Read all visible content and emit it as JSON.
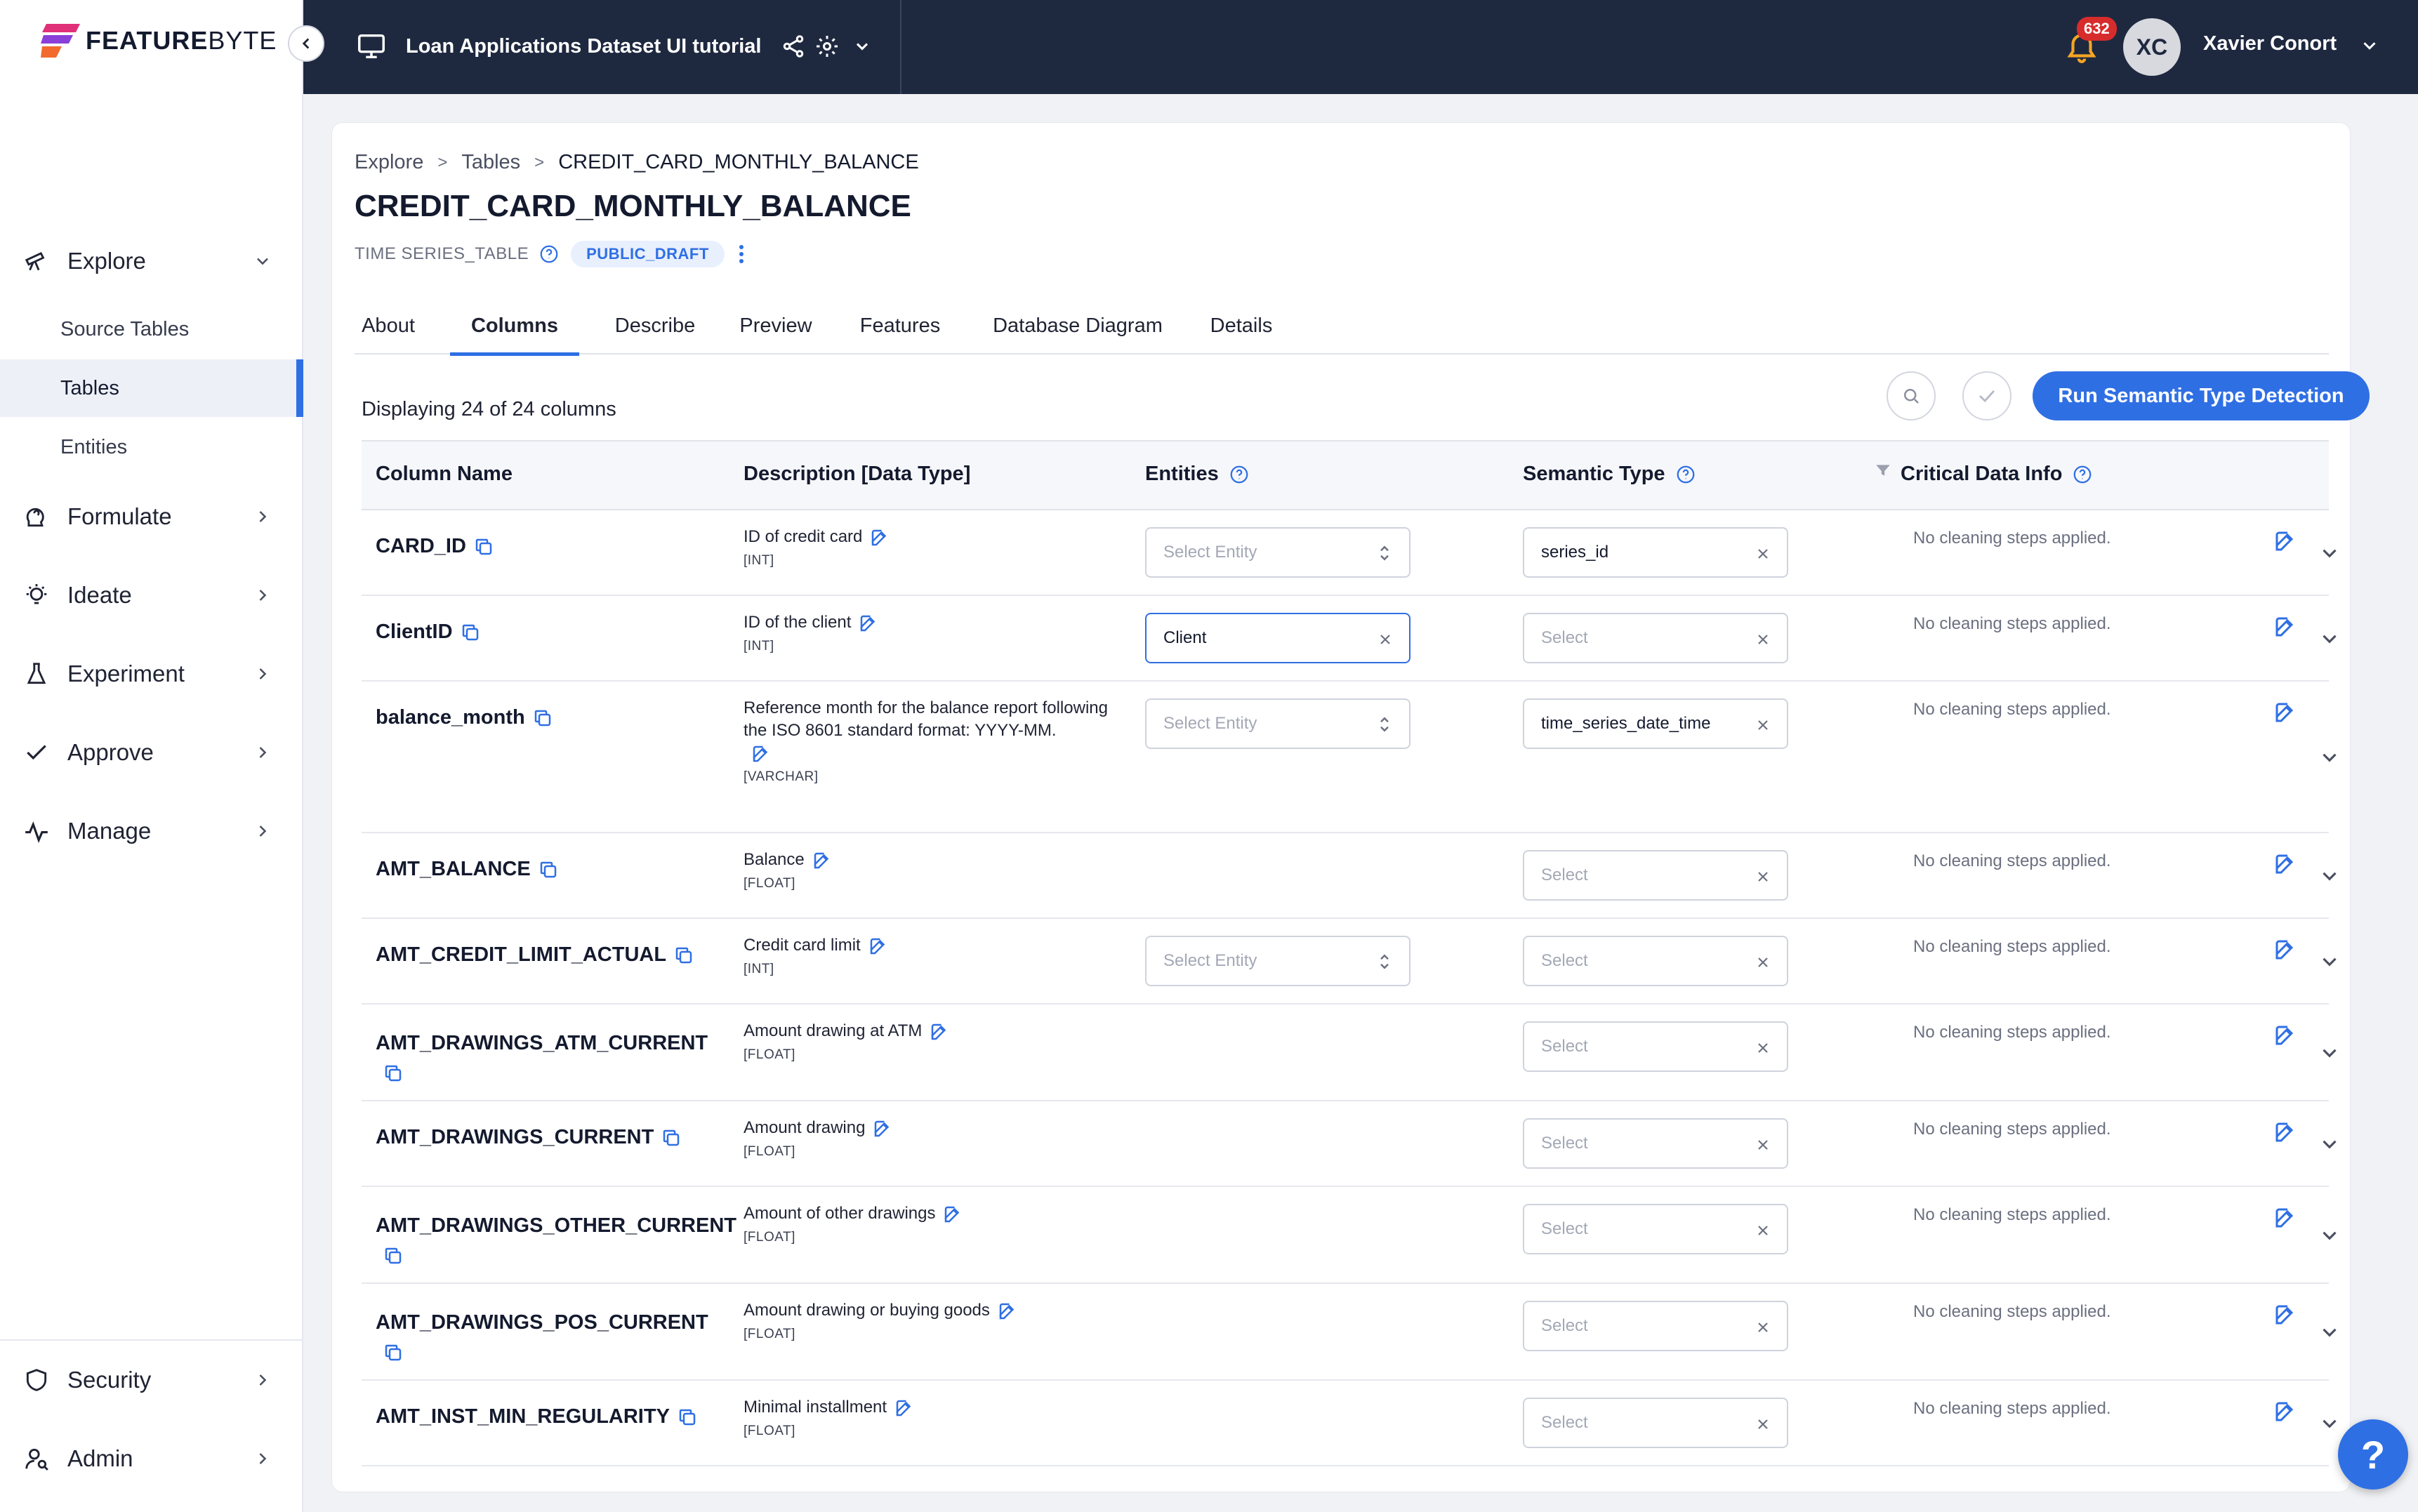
{
  "app": {
    "logo_text_bold": "FEATURE",
    "logo_text_light": "BYTE",
    "project_name": "Loan Applications Dataset UI tutorial",
    "notifications_count": "632",
    "user_initials": "XC",
    "user_name": "Xavier Conort",
    "accent_color": "#2f6fe4",
    "topbar_color": "#1e2940"
  },
  "sidebar": {
    "explore": "Explore",
    "sub": [
      "Source Tables",
      "Tables",
      "Entities"
    ],
    "items": [
      "Formulate",
      "Ideate",
      "Experiment",
      "Approve",
      "Manage"
    ],
    "bottom": [
      "Security",
      "Admin"
    ]
  },
  "breadcrumb": [
    "Explore",
    "Tables",
    "CREDIT_CARD_MONTHLY_BALANCE"
  ],
  "page": {
    "title": "CREDIT_CARD_MONTHLY_BALANCE",
    "table_type": "TIME SERIES_TABLE",
    "status": "PUBLIC_DRAFT"
  },
  "tabs": [
    "About",
    "Columns",
    "Describe",
    "Preview",
    "Features",
    "Database Diagram",
    "Details"
  ],
  "active_tab": "Columns",
  "toolbar": {
    "display_count": "Displaying 24 of 24 columns",
    "run_button": "Run Semantic Type Detection"
  },
  "table": {
    "headers": [
      "Column Name",
      "Description [Data Type]",
      "Entities",
      "Semantic Type",
      "Critical Data Info"
    ],
    "rows": [
      {
        "name": "CARD_ID",
        "desc": "ID of credit card",
        "dtype": "[INT]",
        "entity": "Select Entity",
        "entity_state": "placeholder",
        "semantic": "series_id",
        "semantic_state": "filled",
        "cdi": "No cleaning steps applied."
      },
      {
        "name": "ClientID",
        "desc": "ID of the client",
        "dtype": "[INT]",
        "entity": "Client",
        "entity_state": "focus",
        "semantic": "Select",
        "semantic_state": "placeholder",
        "cdi": "No cleaning steps applied."
      },
      {
        "name": "balance_month",
        "desc": "Reference month for the balance report following the ISO 8601 standard format: YYYY-MM.",
        "dtype": "[VARCHAR]",
        "entity": "Select Entity",
        "entity_state": "placeholder",
        "semantic": "time_series_date_time",
        "semantic_state": "filled",
        "cdi": "No cleaning steps applied."
      },
      {
        "name": "AMT_BALANCE",
        "desc": "Balance",
        "dtype": "[FLOAT]",
        "entity": "",
        "entity_state": "none",
        "semantic": "Select",
        "semantic_state": "placeholder",
        "cdi": "No cleaning steps applied."
      },
      {
        "name": "AMT_CREDIT_LIMIT_ACTUAL",
        "desc": "Credit card limit",
        "dtype": "[INT]",
        "entity": "Select Entity",
        "entity_state": "placeholder",
        "semantic": "Select",
        "semantic_state": "placeholder",
        "cdi": "No cleaning steps applied."
      },
      {
        "name": "AMT_DRAWINGS_ATM_CURRENT",
        "desc": "Amount drawing at ATM",
        "dtype": "[FLOAT]",
        "entity": "",
        "entity_state": "none",
        "semantic": "Select",
        "semantic_state": "placeholder",
        "cdi": "No cleaning steps applied."
      },
      {
        "name": "AMT_DRAWINGS_CURRENT",
        "desc": "Amount drawing",
        "dtype": "[FLOAT]",
        "entity": "",
        "entity_state": "none",
        "semantic": "Select",
        "semantic_state": "placeholder",
        "cdi": "No cleaning steps applied."
      },
      {
        "name": "AMT_DRAWINGS_OTHER_CURRENT",
        "desc": "Amount of other drawings",
        "dtype": "[FLOAT]",
        "entity": "",
        "entity_state": "none",
        "semantic": "Select",
        "semantic_state": "placeholder",
        "cdi": "No cleaning steps applied."
      },
      {
        "name": "AMT_DRAWINGS_POS_CURRENT",
        "desc": "Amount drawing or buying goods",
        "dtype": "[FLOAT]",
        "entity": "",
        "entity_state": "none",
        "semantic": "Select",
        "semantic_state": "placeholder",
        "cdi": "No cleaning steps applied."
      },
      {
        "name": "AMT_INST_MIN_REGULARITY",
        "desc": "Minimal installment",
        "dtype": "[FLOAT]",
        "entity": "",
        "entity_state": "none",
        "semantic": "Select",
        "semantic_state": "placeholder",
        "cdi": "No cleaning steps applied."
      }
    ]
  },
  "help_label": "?"
}
